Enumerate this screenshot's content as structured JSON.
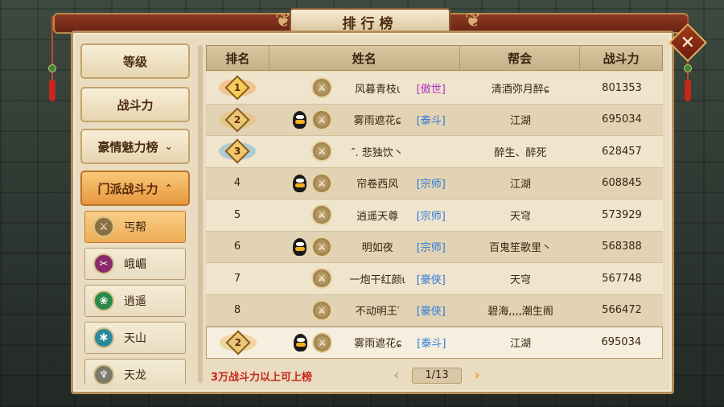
{
  "window": {
    "title": "排行榜"
  },
  "categories": [
    {
      "label": "等级",
      "chevron": ""
    },
    {
      "label": "战斗力",
      "chevron": ""
    },
    {
      "label": "豪情魅力榜",
      "chevron": "⌄"
    },
    {
      "label": "门派战斗力",
      "chevron": "⌃"
    }
  ],
  "sects": [
    {
      "label": "丐帮",
      "icon": "sword-icon",
      "color": "#8a7040",
      "active": true
    },
    {
      "label": "峨嵋",
      "icon": "blades-icon",
      "color": "#8a2a6a",
      "active": false
    },
    {
      "label": "逍遥",
      "icon": "leaf-icon",
      "color": "#2a8a4a",
      "active": false
    },
    {
      "label": "天山",
      "icon": "snow-icon",
      "color": "#2a8a9a",
      "active": false
    },
    {
      "label": "天龙",
      "icon": "dragon-icon",
      "color": "#7a7a6a",
      "active": false
    }
  ],
  "table": {
    "headers": {
      "rank": "排名",
      "name": "姓名",
      "guild": "帮会",
      "power": "战斗力"
    },
    "rows": [
      {
        "rank": "1",
        "medal": "gold",
        "qq": false,
        "name": "风暮青枝ι",
        "title": "[傲世]",
        "title_color": "purple",
        "guild": "清酒弥月醉ɕ",
        "power": "801353"
      },
      {
        "rank": "2",
        "medal": "silver",
        "qq": true,
        "name": "雾雨遮花ɕ",
        "title": "[泰斗]",
        "title_color": "blue",
        "guild": "江湖",
        "power": "695034"
      },
      {
        "rank": "3",
        "medal": "bronze",
        "qq": false,
        "name": "″. 悲独饮丶",
        "title": "",
        "title_color": "blue",
        "guild": "醉生、醉死",
        "power": "628457"
      },
      {
        "rank": "4",
        "medal": "",
        "qq": true,
        "name": "帘卷西风",
        "title": "[宗师]",
        "title_color": "blue",
        "guild": "江湖",
        "power": "608845"
      },
      {
        "rank": "5",
        "medal": "",
        "qq": false,
        "name": "逍遥天尊",
        "title": "[宗师]",
        "title_color": "blue",
        "guild": "天穹",
        "power": "573929"
      },
      {
        "rank": "6",
        "medal": "",
        "qq": true,
        "name": "明如夜",
        "title": "[宗师]",
        "title_color": "blue",
        "guild": "百鬼笙歌里丶",
        "power": "568388"
      },
      {
        "rank": "7",
        "medal": "",
        "qq": false,
        "name": "一炮干红颜ι",
        "title": "[豪侠]",
        "title_color": "blue",
        "guild": "天穹",
        "power": "567748"
      },
      {
        "rank": "8",
        "medal": "",
        "qq": false,
        "name": "不动明王′",
        "title": "[豪侠]",
        "title_color": "blue",
        "guild": "碧海,,,,潮生阁",
        "power": "566472"
      }
    ],
    "self_row": {
      "rank": "2",
      "medal": "silver",
      "qq": true,
      "name": "雾雨遮花ɕ",
      "title": "[泰斗]",
      "title_color": "blue",
      "guild": "江湖",
      "power": "695034"
    }
  },
  "footer": {
    "note": "3万战斗力以上可上榜",
    "page": "1/13",
    "prev": "‹",
    "next": "›"
  },
  "colors": {
    "blue_title": "#2d79d9",
    "purple_title": "#b132c8",
    "note_red": "#c8261c"
  }
}
